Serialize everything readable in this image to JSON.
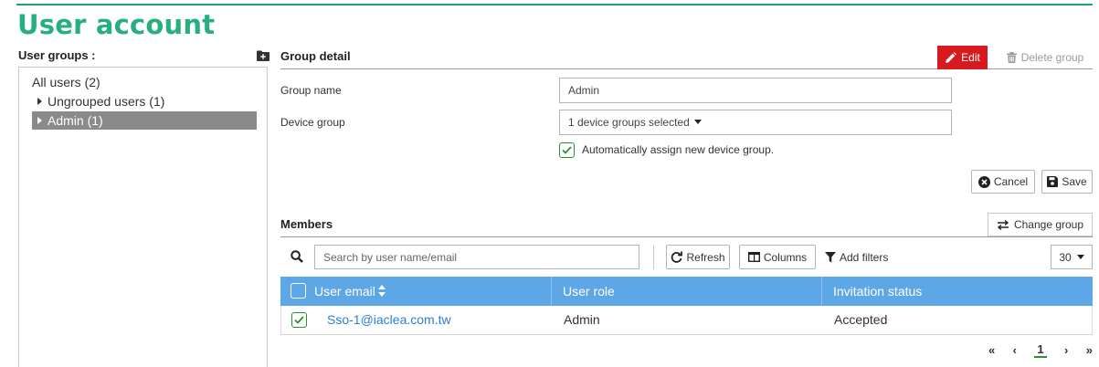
{
  "page": {
    "title": "User account"
  },
  "sidebar": {
    "header_label": "User groups :",
    "add_icon": "folder-plus-icon",
    "all_users_label": "All users (2)",
    "items": [
      {
        "label": "Ungrouped users (1)",
        "selected": false
      },
      {
        "label": "Admin (1)",
        "selected": true
      }
    ]
  },
  "detail": {
    "title": "Group detail",
    "edit_label": "Edit",
    "delete_label": "Delete group",
    "group_name_label": "Group name",
    "group_name_value": "Admin",
    "device_group_label": "Device group",
    "device_group_value": "1 device groups selected",
    "auto_assign_label": "Automatically assign new device group.",
    "auto_assign_checked": true,
    "cancel_label": "Cancel",
    "save_label": "Save"
  },
  "members": {
    "title": "Members",
    "change_group_label": "Change group",
    "search_placeholder": "Search by user name/email",
    "refresh_label": "Refresh",
    "columns_label": "Columns",
    "filters_label": "Add filters",
    "page_size": "30",
    "headers": [
      "User email",
      "User role",
      "Invitation status"
    ],
    "rows": [
      {
        "checked": true,
        "email": "Sso-1@iaclea.com.tw",
        "role": "Admin",
        "status": "Accepted"
      }
    ],
    "pager": {
      "first": "«",
      "prev": "‹",
      "current": "1",
      "next": "›",
      "last": "»"
    }
  },
  "colors": {
    "accent_green": "#27b07e",
    "edit_red": "#d71920",
    "table_header_blue": "#5ea7e6",
    "link_blue": "#2a7fd4"
  }
}
